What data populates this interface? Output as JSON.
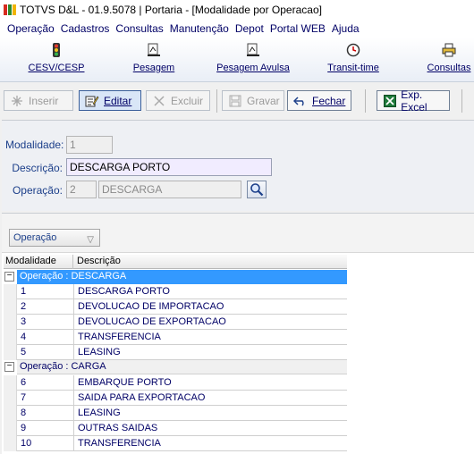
{
  "window": {
    "title": "TOTVS D&L - 01.9.5078 | Portaria - [Modalidade por Operacao]"
  },
  "menu": [
    "Operação",
    "Cadastros",
    "Consultas",
    "Manutenção",
    "Depot",
    "Portal WEB",
    "Ajuda"
  ],
  "big_toolbar": [
    {
      "label": "CESV/CESP",
      "icon": "traffic-light-icon"
    },
    {
      "label": "Pesagem",
      "icon": "scale-icon"
    },
    {
      "label": "Pesagem Avulsa",
      "icon": "scale-icon"
    },
    {
      "label": "Transit-time",
      "icon": "clock-icon"
    },
    {
      "label": "Consultas",
      "icon": "printer-icon"
    }
  ],
  "small_toolbar": {
    "inserir": "Inserir",
    "editar": "Editar",
    "excluir": "Excluir",
    "gravar": "Gravar",
    "fechar": "Fechar",
    "exp_excel": "Exp. Excel"
  },
  "form": {
    "modalidade_label": "Modalidade:",
    "modalidade_value": "1",
    "descricao_label": "Descrição:",
    "descricao_value": "DESCARGA PORTO",
    "operacao_label": "Operação:",
    "operacao_code": "2",
    "operacao_desc": "DESCARGA"
  },
  "grid": {
    "group_by": "Operação",
    "columns": [
      "Modalidade",
      "Descrição"
    ],
    "groups": [
      {
        "label": "Operação : DESCARGA",
        "toggle": "−",
        "rows": [
          {
            "mod": "1",
            "desc": "DESCARGA PORTO"
          },
          {
            "mod": "2",
            "desc": "DEVOLUCAO DE IMPORTACAO"
          },
          {
            "mod": "3",
            "desc": "DEVOLUCAO DE EXPORTACAO"
          },
          {
            "mod": "4",
            "desc": "TRANSFERENCIA"
          },
          {
            "mod": "5",
            "desc": "LEASING"
          }
        ]
      },
      {
        "label": "Operação : CARGA",
        "toggle": "−",
        "rows": [
          {
            "mod": "6",
            "desc": "EMBARQUE PORTO"
          },
          {
            "mod": "7",
            "desc": "SAIDA PARA EXPORTACAO"
          },
          {
            "mod": "8",
            "desc": "LEASING"
          },
          {
            "mod": "9",
            "desc": "OUTRAS SAIDAS"
          },
          {
            "mod": "10",
            "desc": "TRANSFERENCIA"
          }
        ]
      }
    ]
  }
}
